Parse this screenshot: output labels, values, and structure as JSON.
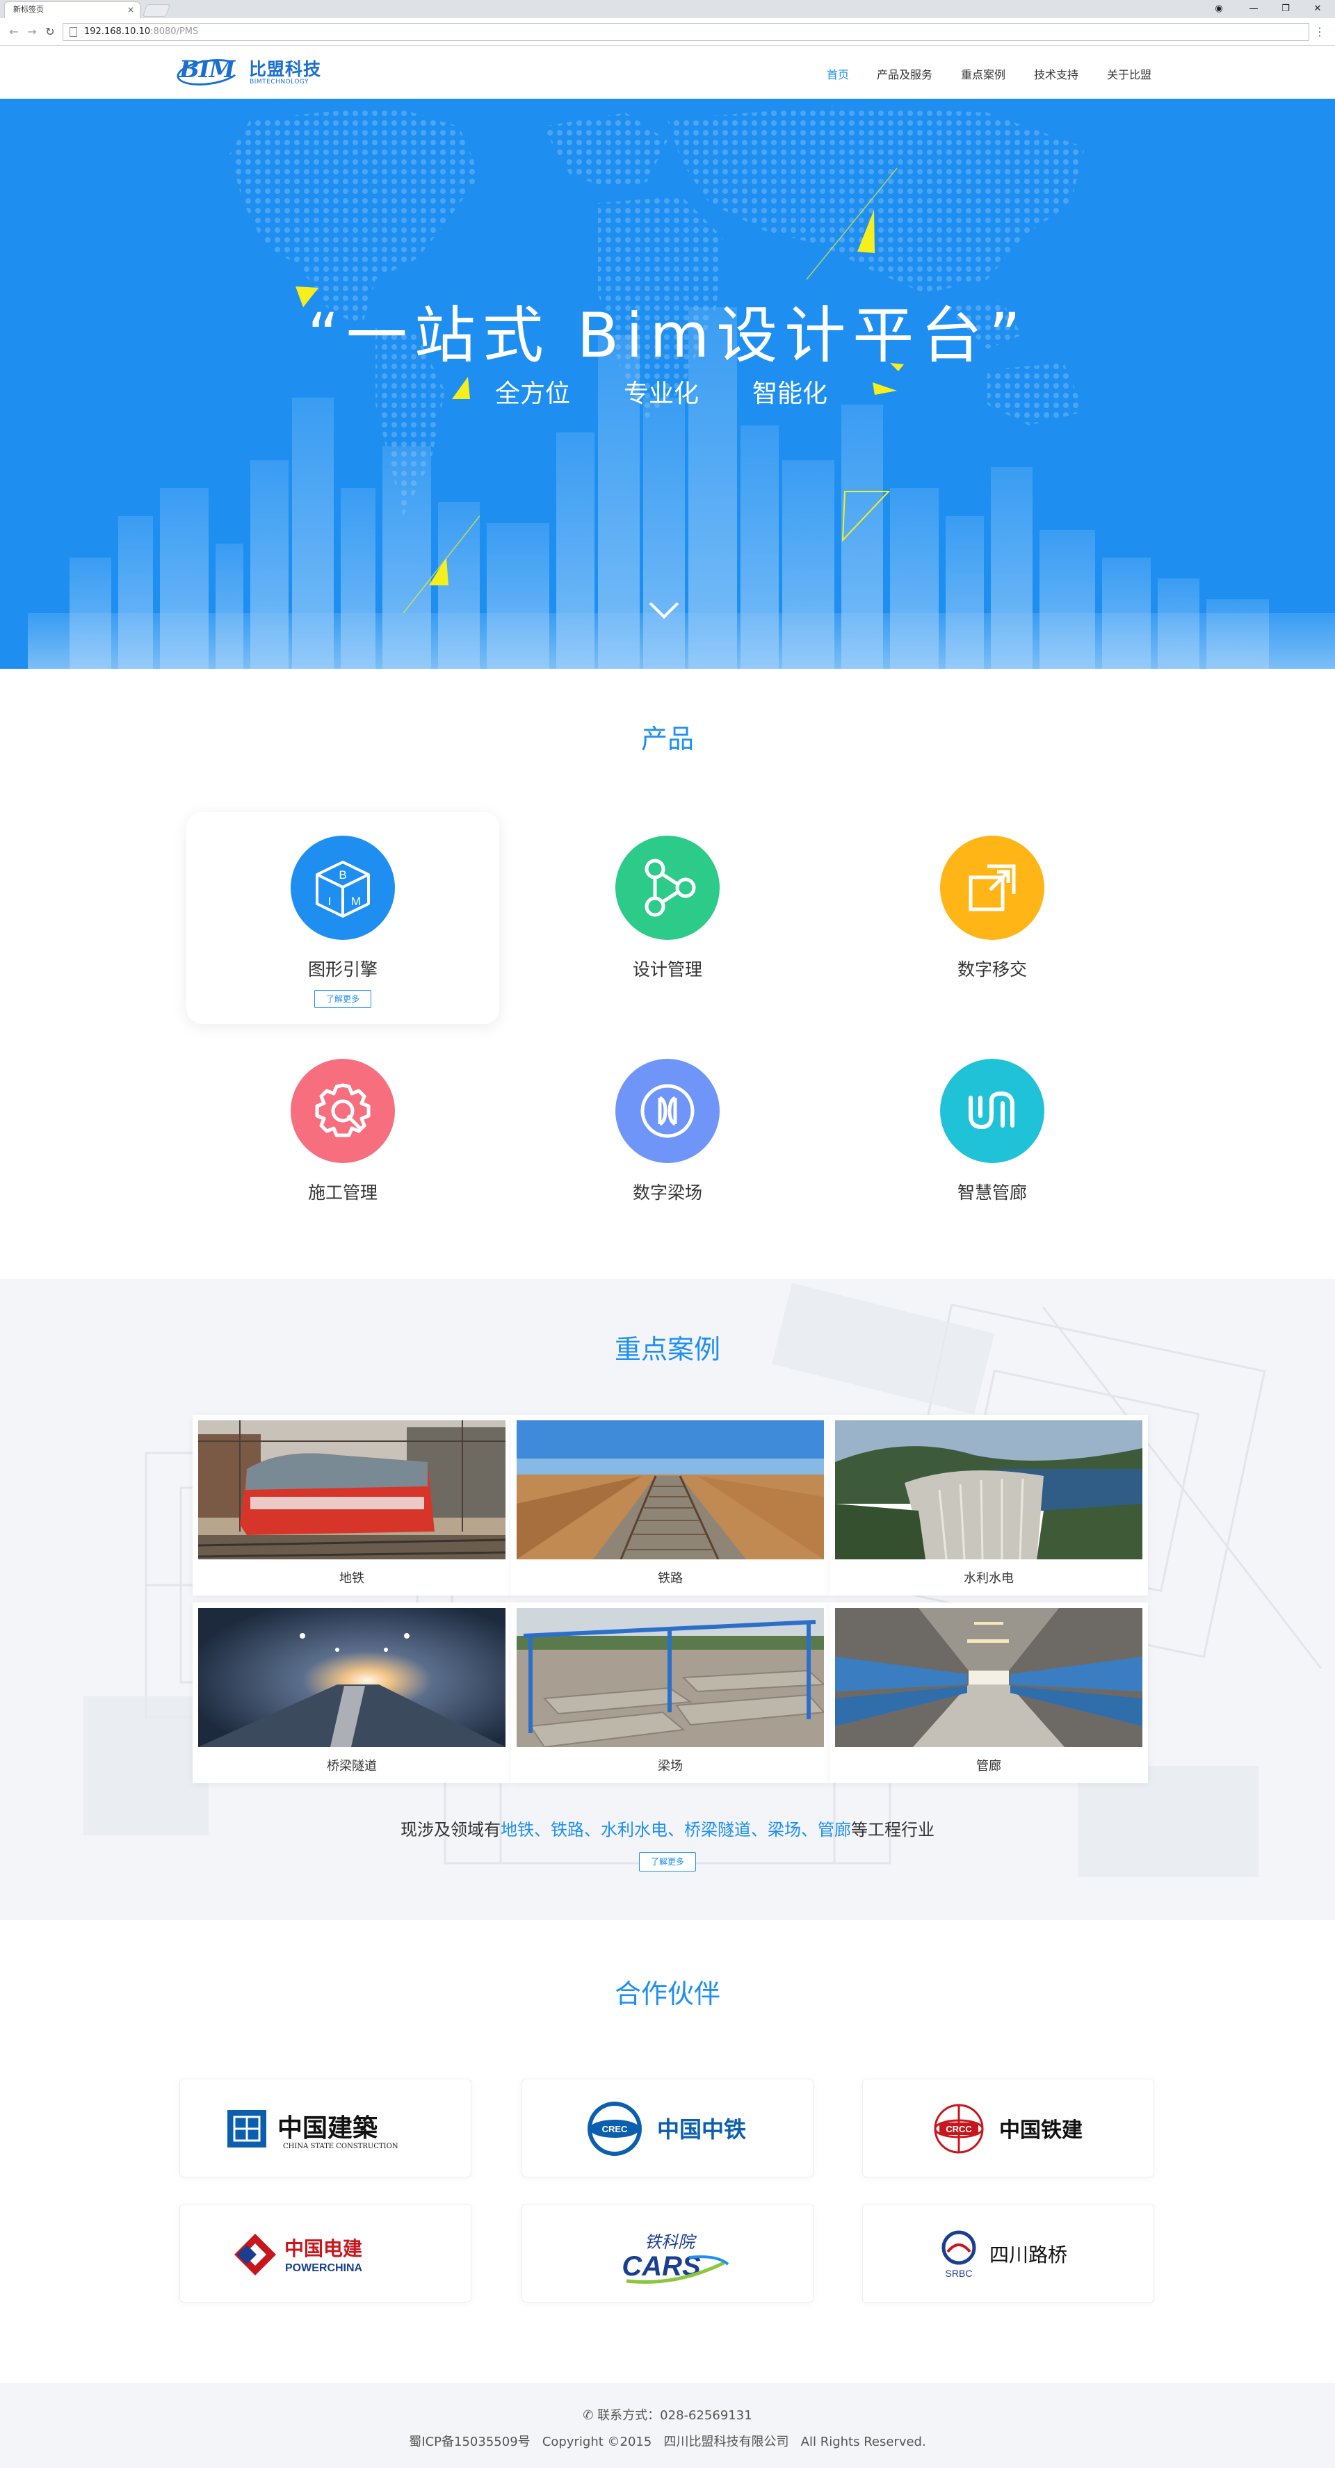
{
  "browser": {
    "tab_title": "新标签页",
    "tab_close": "×",
    "url_host": "192.168.10.10",
    "url_rest": ":8080/PMS",
    "back": "←",
    "forward": "→",
    "reload": "↻",
    "menu": "⋮",
    "win_user": "◉",
    "win_minimize": "—",
    "win_restore": "❐",
    "win_close": "✕"
  },
  "header": {
    "logo_mark": "BIM",
    "logo_cn": "比盟科技",
    "logo_en": "BIMTECHNOLOGY",
    "nav": [
      {
        "label": "首页",
        "active": true
      },
      {
        "label": "产品及服务",
        "active": false
      },
      {
        "label": "重点案例",
        "active": false
      },
      {
        "label": "技术支持",
        "active": false
      },
      {
        "label": "关于比盟",
        "active": false
      }
    ]
  },
  "hero": {
    "title": "“一站式 Bim设计平台”",
    "subs": [
      "全方位",
      "专业化",
      "智能化"
    ],
    "scroll_icon": "chevron-down-icon"
  },
  "products": {
    "title": "产品",
    "more_label": "了解更多",
    "items": [
      {
        "name": "图形引擎",
        "icon": "bim-cube-icon",
        "color": "#1e8ff0",
        "icon_text_b": "B",
        "icon_text_i": "I",
        "icon_text_m": "M"
      },
      {
        "name": "设计管理",
        "icon": "share-nodes-icon",
        "color": "#2dcb8a"
      },
      {
        "name": "数字移交",
        "icon": "transfer-icon",
        "color": "#ffb516"
      },
      {
        "name": "施工管理",
        "icon": "gear-wrench-icon",
        "color": "#f76f7f"
      },
      {
        "name": "数字梁场",
        "icon": "beam-field-icon",
        "color": "#6e95f7"
      },
      {
        "name": "智慧管廊",
        "icon": "pipe-gallery-icon",
        "color": "#20c2d8"
      }
    ]
  },
  "cases": {
    "title": "重点案例",
    "items": [
      {
        "label": "地铁",
        "image": "metro-train-image"
      },
      {
        "label": "铁路",
        "image": "railway-track-image"
      },
      {
        "label": "水利水电",
        "image": "hydro-dam-image"
      },
      {
        "label": "桥梁隧道",
        "image": "tunnel-image"
      },
      {
        "label": "梁场",
        "image": "beam-yard-image"
      },
      {
        "label": "管廊",
        "image": "pipe-corridor-image"
      }
    ],
    "summary_prefix": "现涉及领域有",
    "summary_fields": "地铁、铁路、水利水电、桥梁隧道、梁场、管廊",
    "summary_suffix": "等工程行业",
    "more_label": "了解更多"
  },
  "partners": {
    "title": "合作伙伴",
    "items": [
      {
        "name_cn": "中国建築",
        "name_en": "CHINA STATE CONSTRUCTION",
        "logo": "cscec-logo",
        "color": "#0b5fae"
      },
      {
        "name_cn": "中国中铁",
        "name_en": "CREC",
        "logo": "crec-logo",
        "color": "#0b5fae"
      },
      {
        "name_cn": "中国铁建",
        "name_en": "CRCC",
        "logo": "crcc-logo",
        "color": "#c8161d"
      },
      {
        "name_cn": "中国电建",
        "name_en": "POWERCHINA",
        "logo": "powerchina-logo",
        "color": "#c8161d"
      },
      {
        "name_cn": "铁科院",
        "name_en": "CARS",
        "logo": "cars-logo",
        "color": "#1b3f8f"
      },
      {
        "name_cn": "四川路桥",
        "name_en": "SRBC",
        "logo": "srbc-logo",
        "color": "#1b3f8f"
      }
    ]
  },
  "footer": {
    "phone_icon": "phone-icon",
    "contact_label": "联系方式：",
    "phone": "028-62569131",
    "icp": "蜀ICP备15035509号",
    "copyright": "Copyright ©2015",
    "company": "四川比盟科技有限公司",
    "rights": "All Rights Reserved."
  }
}
